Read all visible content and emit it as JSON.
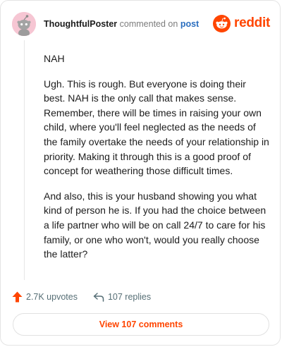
{
  "comment": {
    "username": "ThoughtfulPoster",
    "action_text": "commented on",
    "target_link": "post",
    "paragraphs": [
      "NAH",
      "Ugh. This is rough. But everyone is doing their best. NAH is the only call that makes sense. Remember, there will be times in raising your own child, where you'll feel neglected as the needs of the family overtake the needs of your relationship in priority. Making it through this is a good proof of concept for weathering those difficult times.",
      "And also, this is your husband showing you what kind of person he is. If you had the choice between a life partner who will be on call 24/7 to care for his family, or one who won't, would you really choose the latter?"
    ]
  },
  "brand": {
    "wordmark": "reddit",
    "accent_color": "#ff4500",
    "icon": "reddit-snoo-icon"
  },
  "actions": {
    "upvotes_label": "2.7K upvotes",
    "upvote_icon": "upvote-arrow-icon",
    "replies_label": "107 replies",
    "reply_icon": "reply-arrow-icon"
  },
  "view_comments_label": "View 107 comments"
}
